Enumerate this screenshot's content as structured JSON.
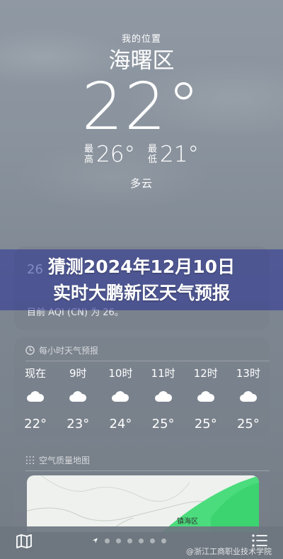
{
  "header": {
    "location_label": "我的位置",
    "city": "海曙区",
    "temperature": "22°",
    "high_label_1": "最",
    "high_label_2": "高",
    "high_value": "26°",
    "low_label_1": "最",
    "low_label_2": "低",
    "low_value": "21°",
    "condition": "多云"
  },
  "overlay": {
    "line1": "猜测2024年12月10日",
    "line2": "实时大鹏新区天气预报"
  },
  "aqi": {
    "value": "26",
    "description": "目前 AQI (CN) 为 26。"
  },
  "hourly": {
    "title": "每小时天气预报",
    "items": [
      {
        "time": "现在",
        "icon": "cloud-icon",
        "temp": "22°"
      },
      {
        "time": "9时",
        "icon": "cloud-icon",
        "temp": "23°"
      },
      {
        "time": "10时",
        "icon": "cloud-icon",
        "temp": "24°"
      },
      {
        "time": "11时",
        "icon": "cloud-icon",
        "temp": "25°"
      },
      {
        "time": "12时",
        "icon": "cloud-icon",
        "temp": "25°"
      },
      {
        "time": "13时",
        "icon": "cloud-icon",
        "temp": "25°"
      }
    ]
  },
  "air_map": {
    "title": "空气质量地图",
    "place_label": "镇海区"
  },
  "watermark": "@浙江工商职业技术学院",
  "pages": {
    "count": 7,
    "active": 1
  }
}
